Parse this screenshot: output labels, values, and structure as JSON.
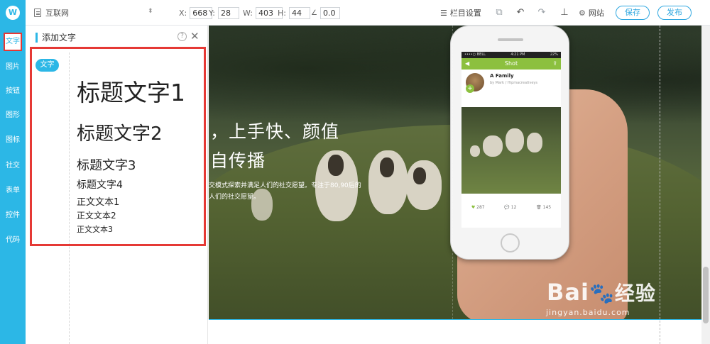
{
  "rail": {
    "logo": "W",
    "items": [
      {
        "label": "文字",
        "active": true
      },
      {
        "label": "图片"
      },
      {
        "label": "按钮"
      },
      {
        "label": "图形"
      },
      {
        "label": "图标"
      },
      {
        "label": "社交"
      },
      {
        "label": "表单"
      },
      {
        "label": "控件"
      },
      {
        "label": "代码"
      }
    ]
  },
  "toolbar": {
    "site": "互联网",
    "x_label": "X:",
    "x_value": "668",
    "y_label": "Y:",
    "y_value": "28",
    "w_label": "W:",
    "w_value": "403",
    "h_label": "H:",
    "h_value": "44",
    "angle_value": "0.0",
    "column_settings": "栏目设置",
    "website": "网站",
    "save": "保存",
    "publish": "发布"
  },
  "panel": {
    "title": "添加文字",
    "tag": "文字",
    "samples": [
      "标题文字1",
      "标题文字2",
      "标题文字3",
      "标题文字4",
      "正文文本1",
      "正文文本2",
      "正文文本3"
    ]
  },
  "hero": {
    "headline1": "，上手快、颜值",
    "headline2": "自传播",
    "para1": "交模式探索并满足人们的社交愿望。专注于80,90后的",
    "para2": "人们的社交愿望。"
  },
  "phone": {
    "status_left": "••••○ BELL",
    "status_mid": "4:21 PM",
    "status_right": "22%",
    "bar_title": "Shot",
    "author": "A Family",
    "byline": "by Mark / Hipmacreativeys",
    "likes": "287",
    "comments": "12",
    "shares": "145"
  },
  "watermark": {
    "brand": "Bai",
    "brand_tail": "经验",
    "url": "jingyan.baidu.com"
  }
}
